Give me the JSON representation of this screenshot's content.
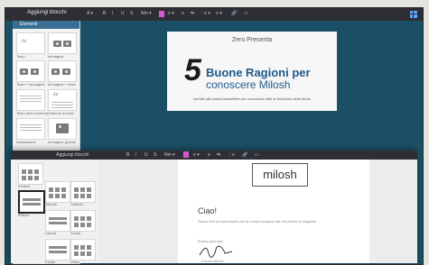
{
  "back_window": {
    "title": "Aggiungi blocchi",
    "toolbar": [
      "A ▾",
      "B",
      "I",
      "U",
      "S",
      "Nm ▾",
      "≡ ▾",
      "≡",
      "⇆",
      "⋮≡ ▾",
      "≡ ▾",
      "🔗",
      "▭"
    ]
  },
  "panel": {
    "header": "Elementi",
    "blocks": [
      {
        "label": "Testo",
        "kind": "text"
      },
      {
        "label": "Immagine",
        "kind": "pic"
      },
      {
        "label": "Testo + immagine",
        "kind": "textpic"
      },
      {
        "label": "Immagine + testo",
        "kind": "pictext"
      },
      {
        "label": "Testo (due colonne)",
        "kind": "lines"
      },
      {
        "label": "Colonne di testo",
        "kind": "textlines"
      },
      {
        "label": "Intestazione",
        "kind": "lines"
      },
      {
        "label": "Immagine grande",
        "kind": "bigpic"
      }
    ]
  },
  "card": {
    "kicker": "Zero Presenta",
    "number": "5",
    "title_line1": "Buone Ragioni per",
    "title_line2": "conoscere Milosh",
    "subtitle": "Iscriviti alla nostra Newsletter per conoscere tutte le tendenze della Moda"
  },
  "front_window": {
    "title": "Aggiungi blocchi",
    "toolbar": [
      "B",
      "I",
      "U",
      "S",
      "Nm ▾",
      "≡ ▾",
      "≡",
      "⇆",
      "⋮≡",
      "🔗",
      "▭"
    ],
    "panel_blocks": [
      {
        "label": "Divisori",
        "kind": "dots"
      },
      {
        "label": "Bottoni",
        "kind": "bars"
      },
      {
        "label": "Tabella",
        "kind": "dots"
      },
      {
        "label": "Galleria",
        "kind": "dots"
      },
      {
        "label": "Layout",
        "kind": "bars"
      },
      {
        "label": "Social",
        "kind": "dots"
      },
      {
        "label": "Footer",
        "kind": "bars"
      },
      {
        "label": "Video",
        "kind": "dots"
      }
    ]
  },
  "document": {
    "logo": "milosh",
    "greeting": "Ciao!",
    "paragraph": "Siamo lieti di comunicarti che la nostra boutique sta chiudendo la stagione",
    "sign_label": "Buona giornata,",
    "sign_name": "Il team Milosh"
  }
}
